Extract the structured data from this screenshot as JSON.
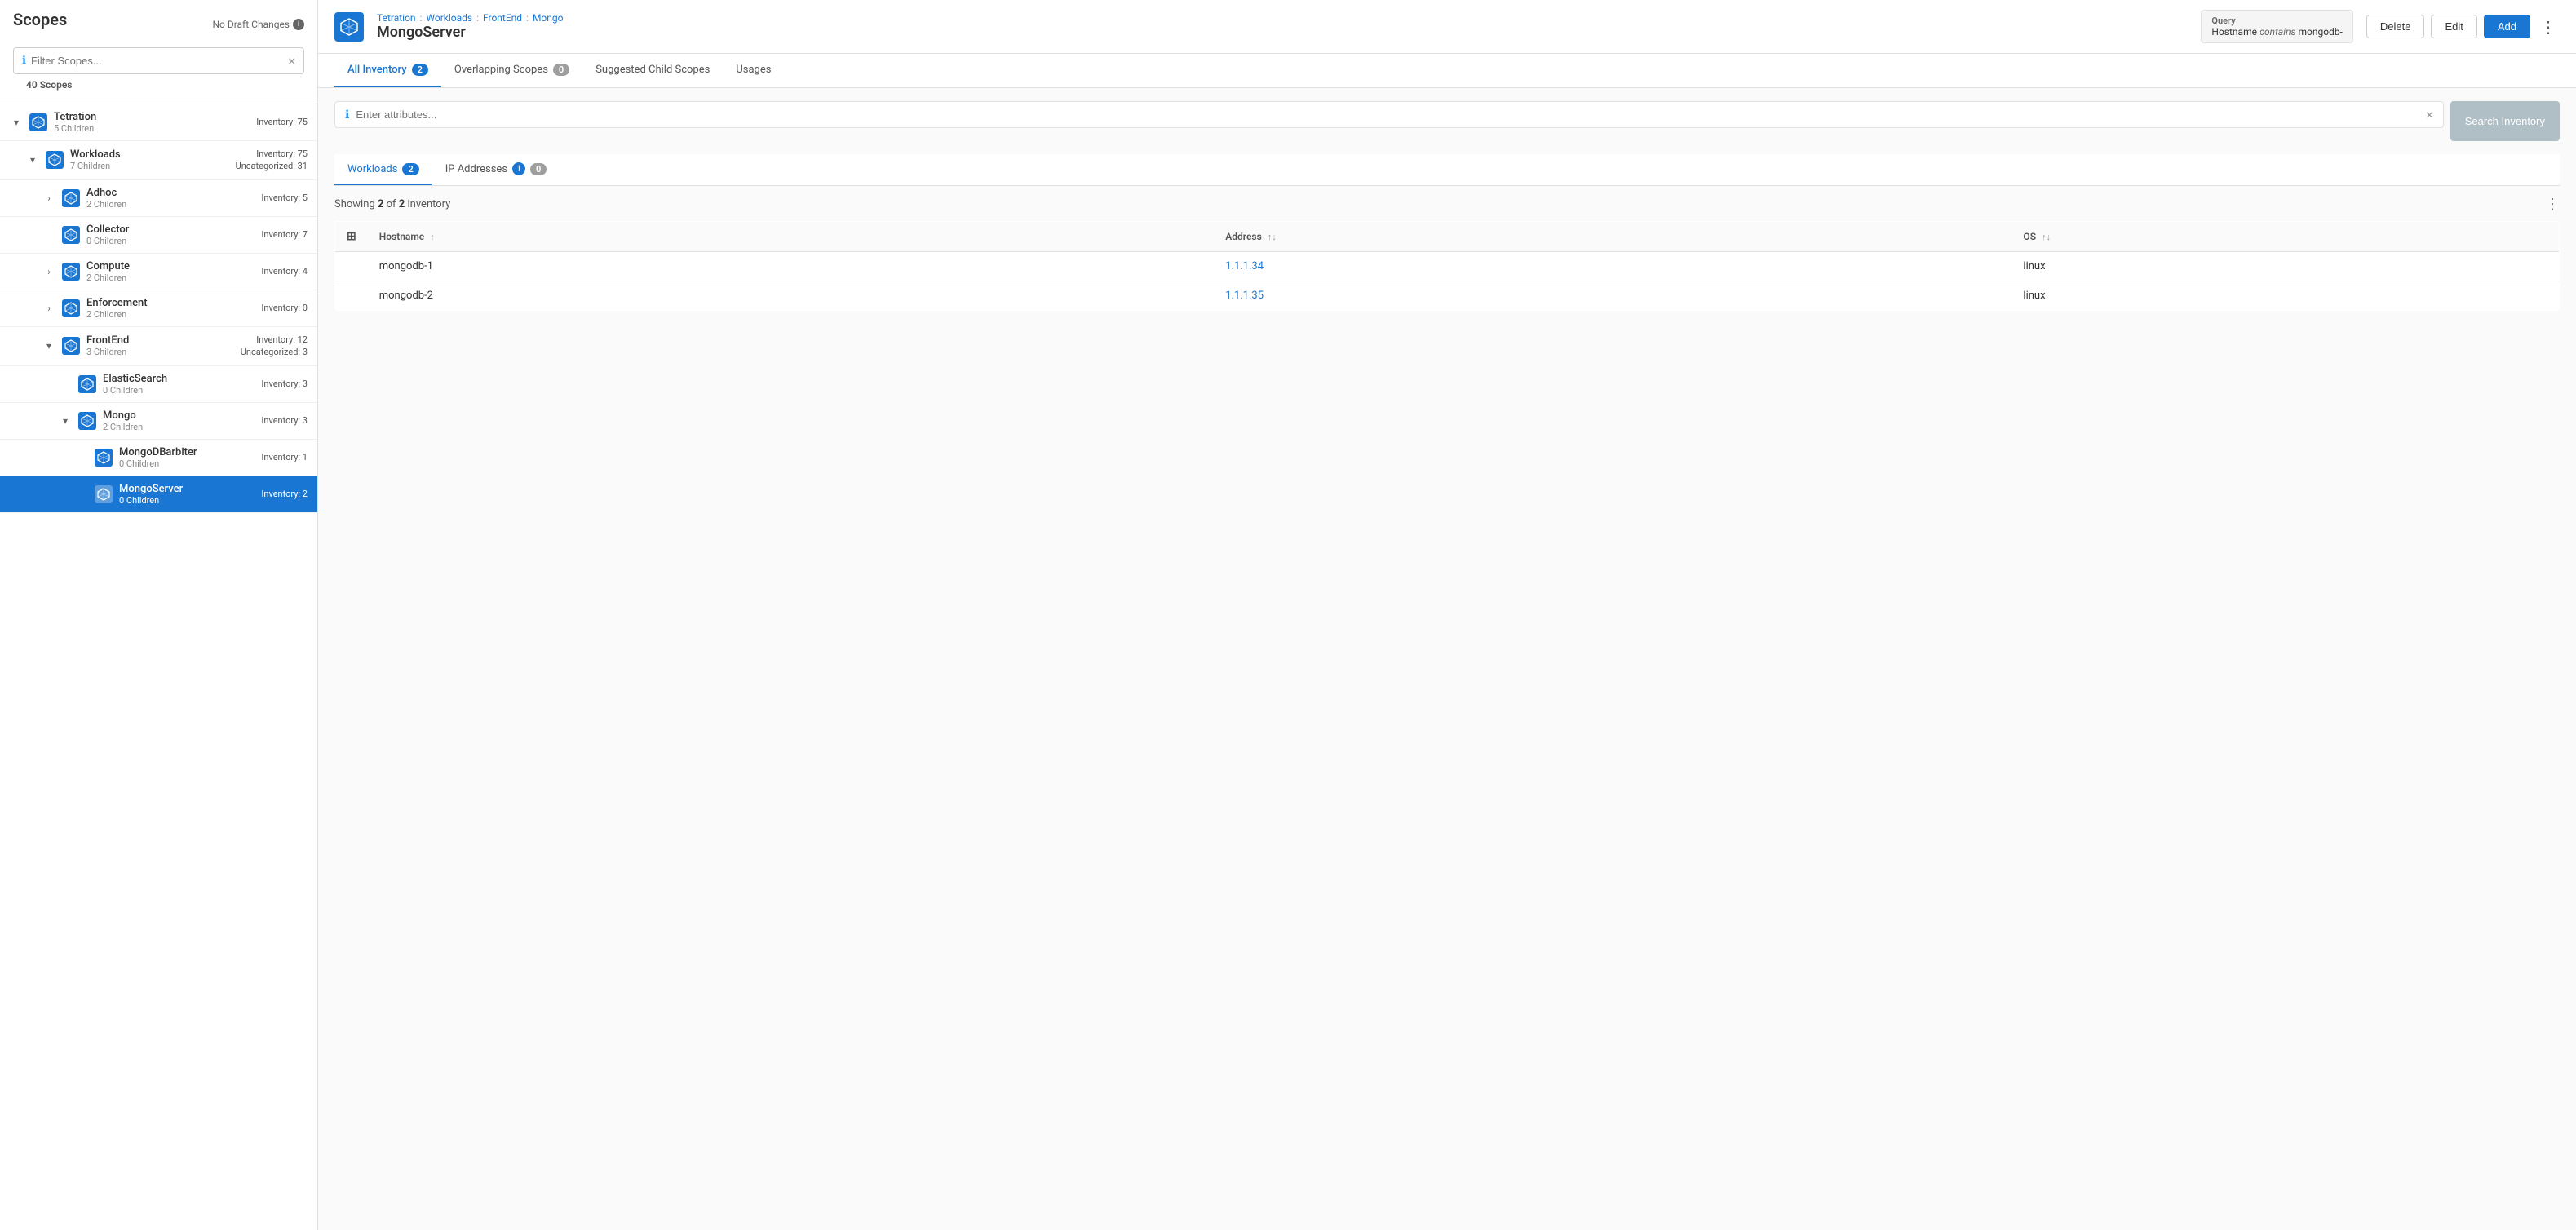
{
  "sidebar": {
    "title": "Scopes",
    "draft_notice": "No Draft Changes",
    "filter_placeholder": "Filter Scopes...",
    "scope_count": "40 Scopes",
    "scopes": [
      {
        "id": "tetration",
        "name": "Tetration",
        "children_label": "5 Children",
        "inventory": "Inventory: 75",
        "indent": 0,
        "expanded": true,
        "toggle": "collapse"
      },
      {
        "id": "workloads",
        "name": "Workloads",
        "children_label": "7 Children",
        "inventory": "Inventory: 75",
        "inventory2": "Uncategorized: 31",
        "indent": 1,
        "expanded": true,
        "toggle": "collapse"
      },
      {
        "id": "adhoc",
        "name": "Adhoc",
        "children_label": "2 Children",
        "inventory": "Inventory: 5",
        "indent": 2,
        "expanded": false,
        "toggle": "expand"
      },
      {
        "id": "collector",
        "name": "Collector",
        "children_label": "0 Children",
        "inventory": "Inventory: 7",
        "indent": 2,
        "expanded": false,
        "toggle": "none"
      },
      {
        "id": "compute",
        "name": "Compute",
        "children_label": "2 Children",
        "inventory": "Inventory: 4",
        "indent": 2,
        "expanded": false,
        "toggle": "expand"
      },
      {
        "id": "enforcement",
        "name": "Enforcement",
        "children_label": "2 Children",
        "inventory": "Inventory: 0",
        "indent": 2,
        "expanded": false,
        "toggle": "expand"
      },
      {
        "id": "frontend",
        "name": "FrontEnd",
        "children_label": "3 Children",
        "inventory": "Inventory: 12",
        "inventory2": "Uncategorized: 3",
        "indent": 2,
        "expanded": true,
        "toggle": "collapse"
      },
      {
        "id": "elasticsearch",
        "name": "ElasticSearch",
        "children_label": "0 Children",
        "inventory": "Inventory: 3",
        "indent": 3,
        "expanded": false,
        "toggle": "none"
      },
      {
        "id": "mongo",
        "name": "Mongo",
        "children_label": "2 Children",
        "inventory": "Inventory: 3",
        "indent": 3,
        "expanded": true,
        "toggle": "collapse"
      },
      {
        "id": "mongodbarbiter",
        "name": "MongoDBarbiter",
        "children_label": "0 Children",
        "inventory": "Inventory: 1",
        "indent": 4,
        "expanded": false,
        "toggle": "none"
      },
      {
        "id": "mongoserver",
        "name": "MongoServer",
        "children_label": "0 Children",
        "inventory": "Inventory: 2",
        "indent": 4,
        "expanded": false,
        "active": true,
        "toggle": "none"
      }
    ]
  },
  "header": {
    "breadcrumb": [
      "Tetration",
      "Workloads",
      "FrontEnd",
      "Mongo"
    ],
    "breadcrumb_seps": [
      ":",
      ":",
      ":"
    ],
    "title": "MongoServer",
    "query_label": "Query",
    "query_text": "Hostname",
    "query_operator": "contains",
    "query_value": "mongodb-",
    "buttons": {
      "delete": "Delete",
      "edit": "Edit",
      "add": "Add"
    }
  },
  "tabs": [
    {
      "id": "all-inventory",
      "label": "All Inventory",
      "badge": "2",
      "active": true
    },
    {
      "id": "overlapping-scopes",
      "label": "Overlapping Scopes",
      "badge": "0",
      "active": false
    },
    {
      "id": "suggested-child-scopes",
      "label": "Suggested Child Scopes",
      "active": false
    },
    {
      "id": "usages",
      "label": "Usages",
      "active": false
    }
  ],
  "search": {
    "placeholder": "Enter attributes...",
    "button_label": "Search Inventory"
  },
  "inner_tabs": [
    {
      "id": "workloads",
      "label": "Workloads",
      "badge": "2",
      "active": true
    },
    {
      "id": "ip-addresses",
      "label": "IP Addresses",
      "badge": "1",
      "badge2": "0",
      "active": false
    }
  ],
  "table": {
    "showing_text": "Showing",
    "showing_count": "2",
    "showing_of": "of",
    "showing_total": "2",
    "showing_label": "inventory",
    "columns": [
      {
        "id": "hostname",
        "label": "Hostname",
        "sort": "asc"
      },
      {
        "id": "address",
        "label": "Address",
        "sort": "sortable"
      },
      {
        "id": "os",
        "label": "OS",
        "sort": "sortable"
      }
    ],
    "rows": [
      {
        "hostname": "mongodb-1",
        "address": "1.1.1.34",
        "os": "linux"
      },
      {
        "hostname": "mongodb-2",
        "address": "1.1.1.35",
        "os": "linux"
      }
    ]
  }
}
